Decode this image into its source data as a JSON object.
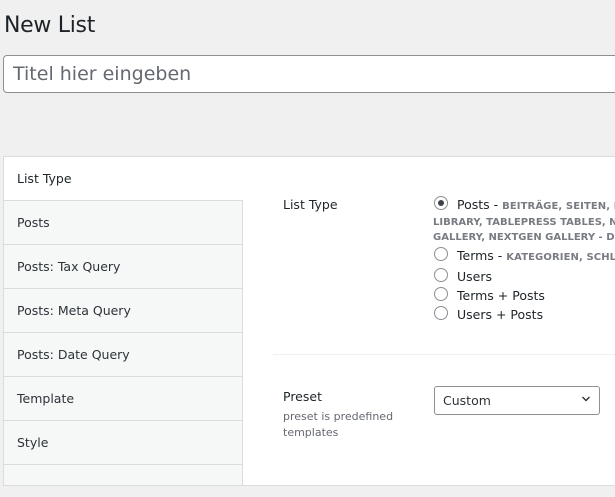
{
  "page": {
    "title": "New List"
  },
  "title_input": {
    "placeholder": "Titel hier eingeben",
    "value": ""
  },
  "tabs": [
    {
      "label": "List Type",
      "active": true
    },
    {
      "label": "Posts"
    },
    {
      "label": "Posts: Tax Query"
    },
    {
      "label": "Posts: Meta Query"
    },
    {
      "label": "Posts: Date Query"
    },
    {
      "label": "Template"
    },
    {
      "label": "Style"
    }
  ],
  "list_type": {
    "label": "List Type",
    "options": [
      {
        "label": "Posts",
        "sep": " - ",
        "desc_line1": "BEITRÄGE, SEITEN, ME",
        "desc_line2": "LIBRARY, TABLEPRESS TABLES, NEXT",
        "desc_line3": "GALLERY, NEXTGEN GALLERY - DISP",
        "checked": true
      },
      {
        "label": "Terms",
        "sep": " - ",
        "desc_line1": "KATEGORIEN, SCHLAG",
        "checked": false
      },
      {
        "label": "Users",
        "checked": false
      },
      {
        "label": "Terms + Posts",
        "checked": false
      },
      {
        "label": "Users + Posts",
        "checked": false
      }
    ]
  },
  "preset": {
    "label": "Preset",
    "description": "preset is predefined templates",
    "selected": "Custom"
  },
  "icons": {
    "select_arrow": "chevron-down-icon"
  },
  "colors": {
    "background": "#f0f0f1",
    "panel": "#ffffff",
    "tab_bg": "#f6f7f7",
    "border": "#dcdcde"
  }
}
